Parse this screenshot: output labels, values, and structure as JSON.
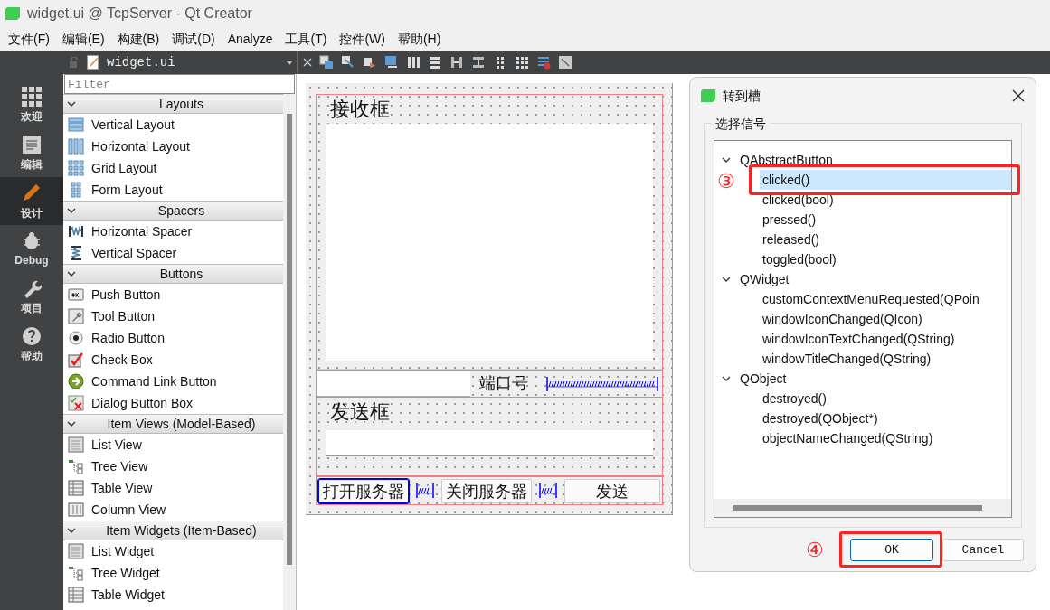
{
  "window": {
    "title": "widget.ui @ TcpServer - Qt Creator"
  },
  "menu": [
    {
      "label": "文件(F)"
    },
    {
      "label": "编辑(E)"
    },
    {
      "label": "构建(B)"
    },
    {
      "label": "调试(D)"
    },
    {
      "label": "Analyze"
    },
    {
      "label": "工具(T)"
    },
    {
      "label": "控件(W)"
    },
    {
      "label": "帮助(H)"
    }
  ],
  "editor_tab": {
    "file": "widget.ui"
  },
  "mode_bar": [
    {
      "label": "欢迎",
      "selected": false
    },
    {
      "label": "编辑",
      "selected": false
    },
    {
      "label": "设计",
      "selected": true
    },
    {
      "label": "Debug",
      "selected": false
    },
    {
      "label": "项目",
      "selected": false
    },
    {
      "label": "帮助",
      "selected": false
    }
  ],
  "widget_box": {
    "filter_placeholder": "Filter",
    "categories": [
      {
        "title": "Layouts",
        "expanded": true,
        "items": [
          "Vertical Layout",
          "Horizontal Layout",
          "Grid Layout",
          "Form Layout"
        ]
      },
      {
        "title": "Spacers",
        "expanded": true,
        "items": [
          "Horizontal Spacer",
          "Vertical Spacer"
        ]
      },
      {
        "title": "Buttons",
        "expanded": true,
        "items": [
          "Push Button",
          "Tool Button",
          "Radio Button",
          "Check Box",
          "Command Link Button",
          "Dialog Button Box"
        ]
      },
      {
        "title": "Item Views (Model-Based)",
        "expanded": true,
        "items": [
          "List View",
          "Tree View",
          "Table View",
          "Column View"
        ]
      },
      {
        "title": "Item Widgets (Item-Based)",
        "expanded": true,
        "items": [
          "List Widget",
          "Tree Widget",
          "Table Widget"
        ]
      }
    ]
  },
  "form": {
    "receive_group": "接收框",
    "port_label": "端口号",
    "send_group": "发送框",
    "buttons": [
      {
        "label": "打开服务器",
        "selected": true
      },
      {
        "label": "关闭服务器",
        "selected": false
      },
      {
        "label": "发送",
        "selected": false
      }
    ]
  },
  "dialog": {
    "title": "转到槽",
    "group_title": "选择信号",
    "signals": [
      {
        "label": "QAbstractButton",
        "expanded": true,
        "children": [
          {
            "label": "clicked()",
            "selected": true
          },
          {
            "label": "clicked(bool)",
            "selected": false
          },
          {
            "label": "pressed()",
            "selected": false
          },
          {
            "label": "released()",
            "selected": false
          },
          {
            "label": "toggled(bool)",
            "selected": false
          }
        ]
      },
      {
        "label": "QWidget",
        "expanded": true,
        "children": [
          {
            "label": "customContextMenuRequested(QPoin",
            "selected": false
          },
          {
            "label": "windowIconChanged(QIcon)",
            "selected": false
          },
          {
            "label": "windowIconTextChanged(QString)",
            "selected": false
          },
          {
            "label": "windowTitleChanged(QString)",
            "selected": false
          }
        ]
      },
      {
        "label": "QObject",
        "expanded": true,
        "children": [
          {
            "label": "destroyed()",
            "selected": false
          },
          {
            "label": "destroyed(QObject*)",
            "selected": false
          },
          {
            "label": "objectNameChanged(QString)",
            "selected": false
          }
        ]
      }
    ],
    "ok": "OK",
    "cancel": "Cancel"
  },
  "annotations": [
    "③",
    "④"
  ]
}
